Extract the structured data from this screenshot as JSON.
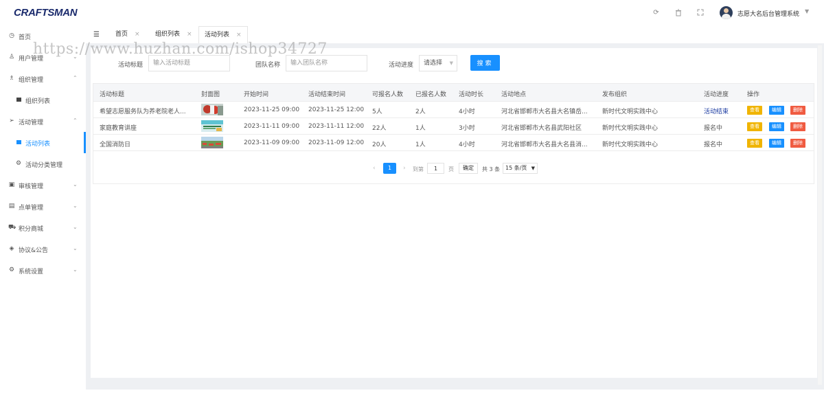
{
  "brand": {
    "logo": "CRAFTSMAN"
  },
  "header": {
    "icons": [
      "refresh-icon",
      "trash-icon",
      "fullscreen-icon"
    ],
    "user_name": "志愿大名后台管理系统"
  },
  "sidebar": {
    "items": [
      {
        "label": "首页",
        "icon": "dashboard-icon",
        "arrow": ""
      },
      {
        "label": "用户管理",
        "icon": "user-icon",
        "arrow": "⌄"
      },
      {
        "label": "组织管理",
        "icon": "team-icon",
        "arrow": "⌃"
      },
      {
        "label": "组织列表",
        "icon": "square-icon",
        "arrow": ""
      },
      {
        "label": "活动管理",
        "icon": "send-icon",
        "arrow": "⌃"
      },
      {
        "label": "活动列表",
        "icon": "square-icon",
        "arrow": ""
      },
      {
        "label": "活动分类管理",
        "icon": "gear-icon",
        "arrow": ""
      },
      {
        "label": "审核管理",
        "icon": "audit-icon",
        "arrow": "⌄"
      },
      {
        "label": "点单管理",
        "icon": "order-icon",
        "arrow": "⌄"
      },
      {
        "label": "积分商城",
        "icon": "cart-icon",
        "arrow": "⌄"
      },
      {
        "label": "协议&公告",
        "icon": "notice-icon",
        "arrow": "⌄"
      },
      {
        "label": "系统设置",
        "icon": "settings-icon",
        "arrow": "⌄"
      }
    ]
  },
  "tabs": [
    {
      "label": "首页",
      "close": "×"
    },
    {
      "label": "组织列表",
      "close": "×"
    },
    {
      "label": "活动列表",
      "close": "×"
    }
  ],
  "filter": {
    "title_label": "活动标题",
    "title_placeholder": "输入活动标题",
    "team_label": "团队名称",
    "team_placeholder": "输入团队名称",
    "progress_label": "活动进度",
    "progress_value": "请选择",
    "search_button": "搜索"
  },
  "table": {
    "columns": [
      "活动标题",
      "封面图",
      "开始时间",
      "活动结束时间",
      "可报名人数",
      "已报名人数",
      "活动时长",
      "活动地点",
      "发布组织",
      "活动进度",
      "操作"
    ],
    "rows": [
      {
        "title": "希望志愿服务队为养老院老人...",
        "start": "2023-11-25 09:00",
        "end": "2023-11-25 12:00",
        "capacity": "5人",
        "enrolled": "2人",
        "duration": "4小时",
        "location": "河北省邯郸市大名县大名镇岳...",
        "org": "新时代文明实践中心",
        "status": "活动结束"
      },
      {
        "title": "家庭教育讲座",
        "start": "2023-11-11 09:00",
        "end": "2023-11-11 12:00",
        "capacity": "22人",
        "enrolled": "1人",
        "duration": "3小时",
        "location": "河北省邯郸市大名县武阳社区",
        "org": "新时代文明实践中心",
        "status": "报名中"
      },
      {
        "title": "全国消防日",
        "start": "2023-11-09 09:00",
        "end": "2023-11-09 12:00",
        "capacity": "20人",
        "enrolled": "1人",
        "duration": "4小时",
        "location": "河北省邯郸市大名县大名县消...",
        "org": "新时代文明实践中心",
        "status": "报名中"
      }
    ],
    "actions": {
      "view": "查看",
      "edit": "编辑",
      "delete": "删除"
    }
  },
  "pagination": {
    "current": "1",
    "goto_label": "到第",
    "goto_value": "1",
    "page_suffix": "页",
    "confirm": "确定",
    "total": "共 3 条",
    "page_size": "15 条/页"
  },
  "watermark": "https://www.huzhan.com/ishop34727",
  "colors": {
    "primary": "#1890ff",
    "view": "#f0b400",
    "delete": "#f05b41",
    "brand": "#1a2a6c"
  }
}
